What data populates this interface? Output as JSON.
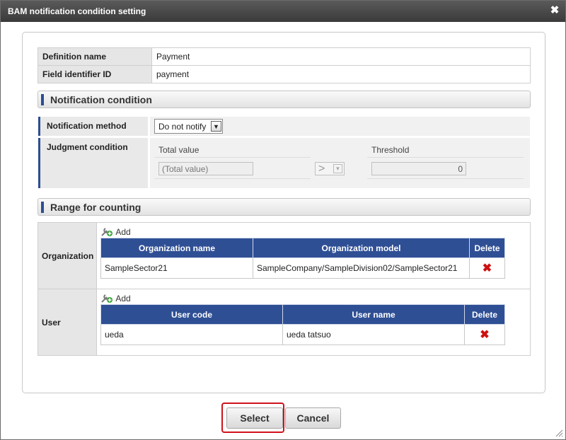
{
  "window": {
    "title": "BAM notification condition setting",
    "close_icon": "close-icon"
  },
  "info": {
    "definition_name_label": "Definition name",
    "definition_name_value": "Payment",
    "field_id_label": "Field identifier ID",
    "field_id_value": "payment"
  },
  "notification_section": {
    "title": "Notification condition",
    "method_label": "Notification method",
    "method_value": "Do not notify",
    "judgment_label": "Judgment condition",
    "total_value_header": "Total value",
    "threshold_header": "Threshold",
    "total_value_field": "(Total value)",
    "operator_value": ">",
    "threshold_value": "0"
  },
  "range_section": {
    "title": "Range for counting",
    "organization": {
      "label": "Organization",
      "add_label": "Add",
      "columns": [
        "Organization name",
        "Organization model",
        "Delete"
      ],
      "rows": [
        {
          "name": "SampleSector21",
          "model": "SampleCompany/SampleDivision02/SampleSector21"
        }
      ]
    },
    "user": {
      "label": "User",
      "add_label": "Add",
      "columns": [
        "User code",
        "User name",
        "Delete"
      ],
      "rows": [
        {
          "code": "ueda",
          "name": "ueda tatsuo"
        }
      ]
    }
  },
  "buttons": {
    "select_label": "Select",
    "cancel_label": "Cancel"
  },
  "colors": {
    "accent": "#2f4f95",
    "delete": "#cc1111",
    "highlight": "#d0121b"
  }
}
